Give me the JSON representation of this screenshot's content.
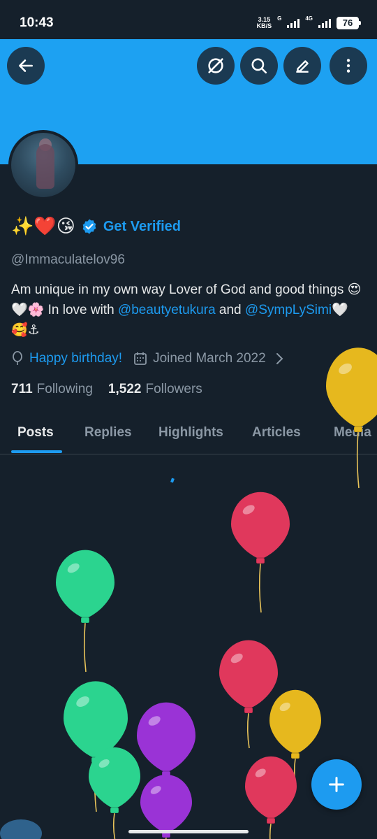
{
  "status": {
    "time": "10:43",
    "speed_top": "3.15",
    "speed_bottom": "KB/S",
    "net1": "G",
    "net2": "4G",
    "battery": "76"
  },
  "header_icons": [
    "back-arrow-icon",
    "grok-icon",
    "search-icon",
    "edit-icon",
    "more-icon"
  ],
  "profile": {
    "name_emoji": "✨❤️😘",
    "get_verified": "Get Verified",
    "handle": "@Immaculatelov96",
    "bio_1": "Am unique in my own way  Lover of God and good things 😍🤍🌸 In love with ",
    "bio_mention_1": "@beautyetukura",
    "bio_2": " and ",
    "bio_mention_2": "@SympLySimi",
    "bio_3": "🤍 🥰⚓",
    "birthday": "Happy birthday!",
    "joined": "Joined March 2022",
    "following_count": "711",
    "following_label": "Following",
    "followers_count": "1,522",
    "followers_label": "Followers"
  },
  "tabs": [
    "Posts",
    "Replies",
    "Highlights",
    "Articles",
    "Media"
  ],
  "active_tab": "Posts",
  "colors": {
    "background": "#15202b",
    "banner": "#1da1f2",
    "accent": "#1d9bf0",
    "balloon_green": "#2bd48f",
    "balloon_red": "#e0385c",
    "balloon_yellow": "#e6b81e",
    "balloon_purple": "#9a33d6"
  }
}
